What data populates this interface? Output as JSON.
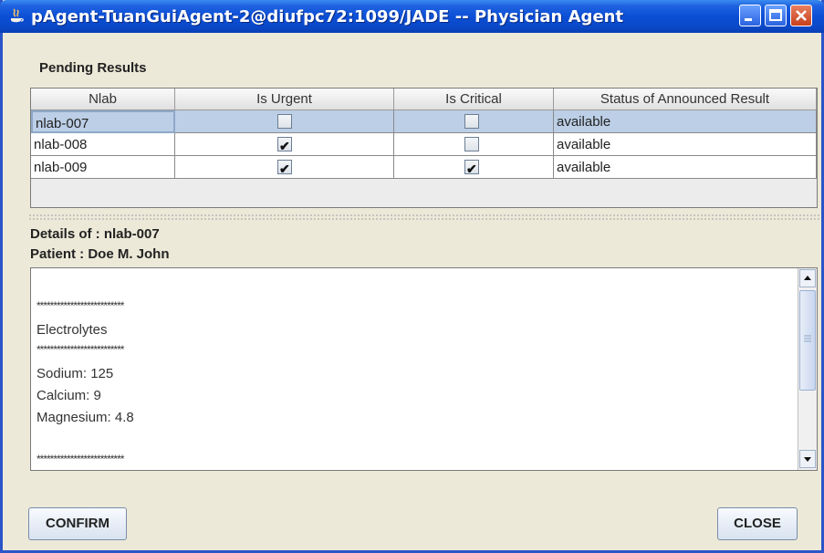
{
  "window": {
    "title": "pAgent-TuanGuiAgent-2@diufpc72:1099/JADE -- Physician Agent",
    "controls": [
      "minimize-icon",
      "maximize-icon",
      "close-icon"
    ]
  },
  "pending": {
    "label": "Pending Results",
    "columns": [
      "Nlab",
      "Is Urgent",
      "Is Critical",
      "Status of Announced Result"
    ],
    "rows": [
      {
        "nlab": "nlab-007",
        "urgent": false,
        "critical": false,
        "status": "available"
      },
      {
        "nlab": "nlab-008",
        "urgent": true,
        "critical": false,
        "status": "available"
      },
      {
        "nlab": "nlab-009",
        "urgent": true,
        "critical": true,
        "status": "available"
      }
    ],
    "selected_row": 0
  },
  "details": {
    "details_of": "Details of : nlab-007",
    "patient": "Patient : Doe M. John",
    "lines": [
      "**************************",
      "Electrolytes",
      "**************************",
      "Sodium: 125",
      "Calcium: 9",
      "Magnesium: 4.8",
      "",
      "**************************"
    ]
  },
  "buttons": {
    "confirm": "CONFIRM",
    "close": "CLOSE"
  }
}
